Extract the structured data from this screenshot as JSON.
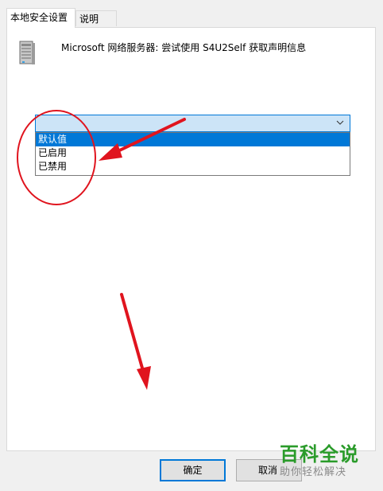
{
  "tabs": [
    {
      "label": "本地安全设置",
      "active": true
    },
    {
      "label": "说明",
      "active": false
    }
  ],
  "policy": {
    "icon": "server-icon",
    "title": "Microsoft 网络服务器: 尝试使用 S4U2Self 获取声明信息"
  },
  "combo": {
    "value": "",
    "options": [
      "默认值",
      "已启用",
      "已禁用"
    ],
    "highlighted_option": "默认值"
  },
  "buttons": {
    "ok_label": "确定",
    "cancel_label": "取消"
  },
  "watermark": {
    "title": "百科全说",
    "subtitle": "助你轻松解决"
  },
  "colors": {
    "accent": "#0078d7",
    "annotation": "#e0141e",
    "watermark": "#2a9b2a"
  }
}
